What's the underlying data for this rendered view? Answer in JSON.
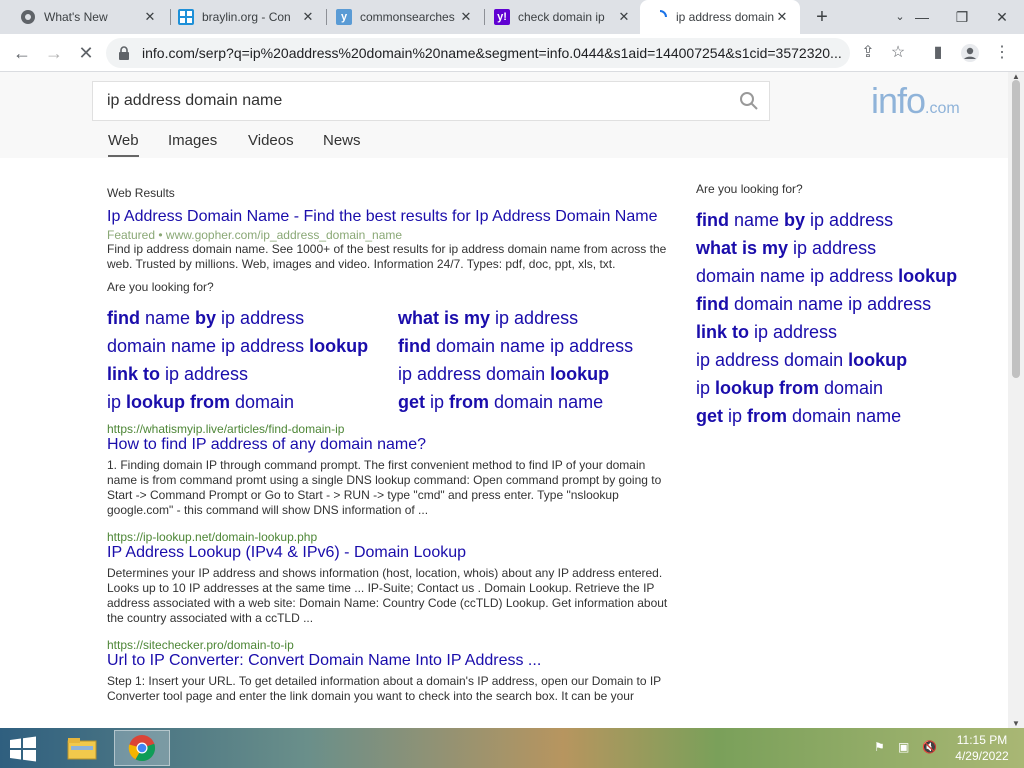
{
  "tabs": [
    {
      "title": "What's New",
      "icon": "chrome-icon",
      "color": "#5f6368"
    },
    {
      "title": "braylin.org - Con",
      "icon": "windows-icon",
      "color": "#1e90d8"
    },
    {
      "title": "commonsearches",
      "icon": "y-icon",
      "color": "#5a9bd5"
    },
    {
      "title": "check domain ip",
      "icon": "yahoo-icon",
      "color": "#6001d2"
    },
    {
      "title": "ip address domain",
      "icon": "loading-icon",
      "color": "#1a73e8"
    }
  ],
  "address_bar": {
    "url": "info.com/serp?q=ip%20address%20domain%20name&segment=info.0444&s1aid=144007254&s1cid=3572320..."
  },
  "search": {
    "query": "ip address domain name"
  },
  "logo": {
    "main": "info",
    "suffix": ".com"
  },
  "nav_tabs": [
    "Web",
    "Images",
    "Videos",
    "News"
  ],
  "main": {
    "web_results_label": "Web Results",
    "featured": {
      "title": "Ip Address Domain Name - Find the best results for Ip Address Domain Name",
      "featured_label": "Featured",
      "url": "www.gopher.com/ip_address_domain_name",
      "desc": "Find ip address domain name. See 1000+ of the best results for ip address domain name from across the web. Trusted by millions. Web, images and video. Information 24/7. Types: pdf, doc, ppt, xls, txt.",
      "looking_for": "Are you looking for?"
    },
    "keywords": [
      {
        "b1": "find",
        "t1": " name ",
        "b2": "by",
        "t2": " ip address"
      },
      {
        "b1": "what is my",
        "t1": " ip address",
        "b2": "",
        "t2": ""
      },
      {
        "b1": "",
        "t1": "domain name ip address ",
        "b2": "lookup",
        "t2": ""
      },
      {
        "b1": "find",
        "t1": " domain name ip address",
        "b2": "",
        "t2": ""
      },
      {
        "b1": "link to",
        "t1": " ip address",
        "b2": "",
        "t2": ""
      },
      {
        "b1": "",
        "t1": "ip address domain ",
        "b2": "lookup",
        "t2": ""
      },
      {
        "b1": "",
        "t1": "ip ",
        "b2": "lookup from",
        "t2": " domain"
      },
      {
        "b1": "get",
        "t1": " ip ",
        "b2": "from",
        "t2": " domain name"
      }
    ],
    "results": [
      {
        "url": "https://whatismyip.live/articles/find-domain-ip",
        "title": "How to find IP address of any domain name?",
        "desc": "1. Finding domain IP through command prompt. The first convenient method to find IP of your domain name is from command promt using a single DNS lookup command: Open command prompt by going to Start -> Command Prompt or Go to Start - > RUN -> type \"cmd\" and press enter. Type \"nslookup google.com\" - this command will show DNS information of ..."
      },
      {
        "url": "https://ip-lookup.net/domain-lookup.php",
        "title": "IP Address Lookup (IPv4 & IPv6) - Domain Lookup",
        "desc": "Determines your IP address and shows information (host, location, whois) about any IP address entered. Looks up to 10 IP addresses at the same time ... IP-Suite; Contact us . Domain Lookup. Retrieve the IP address associated with a web site: Domain Name: Country Code (ccTLD) Lookup. Get information about the country associated with a ccTLD ..."
      },
      {
        "url": "https://sitechecker.pro/domain-to-ip",
        "title": "Url to IP Converter: Convert Domain Name Into IP Address ...",
        "desc": "Step 1: Insert your URL. To get detailed information about a domain's IP address, open our Domain to IP Converter tool page and enter the link domain you want to check into the search box. It can be your"
      }
    ]
  },
  "sidebar": {
    "looking_for": "Are you looking for?",
    "keywords": [
      {
        "b1": "find",
        "t1": " name ",
        "b2": "by",
        "t2": " ip address"
      },
      {
        "b1": "what is my",
        "t1": " ip address",
        "b2": "",
        "t2": ""
      },
      {
        "b1": "",
        "t1": "domain name ip address ",
        "b2": "lookup",
        "t2": ""
      },
      {
        "b1": "find",
        "t1": " domain name ip address",
        "b2": "",
        "t2": ""
      },
      {
        "b1": "link to",
        "t1": " ip address",
        "b2": "",
        "t2": ""
      },
      {
        "b1": "",
        "t1": "ip address domain ",
        "b2": "lookup",
        "t2": ""
      },
      {
        "b1": "",
        "t1": "ip ",
        "b2": "lookup from",
        "t2": " domain"
      },
      {
        "b1": "get",
        "t1": " ip ",
        "b2": "from",
        "t2": " domain name"
      }
    ]
  },
  "taskbar": {
    "time": "11:15 PM",
    "date": "4/29/2022"
  },
  "colors": {
    "link": "#1a0dab",
    "url_green": "#4d8636",
    "logo": "#8fb3d9"
  }
}
